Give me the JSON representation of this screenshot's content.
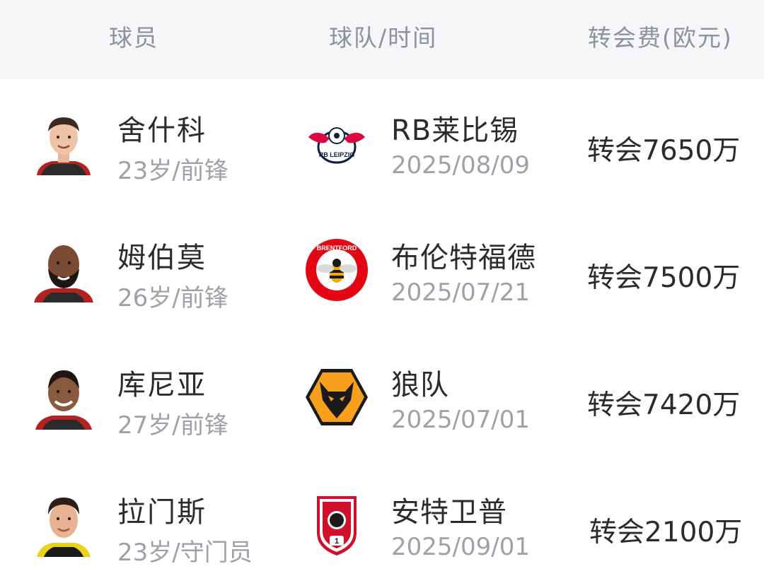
{
  "header": {
    "player_label": "球员",
    "team_time_label": "球队/时间",
    "fee_label": "转会费(欧元)"
  },
  "rows": [
    {
      "player_name": "舍什科",
      "player_info": "23岁/前锋",
      "team_name": "RB莱比锡",
      "date": "2025/08/09",
      "fee": "转会7650万",
      "logo_text": "RB LEIPZIG"
    },
    {
      "player_name": "姆伯莫",
      "player_info": "26岁/前锋",
      "team_name": "布伦特福德",
      "date": "2025/07/21",
      "fee": "转会7500万",
      "logo_text": "BRENTFORD"
    },
    {
      "player_name": "库尼亚",
      "player_info": "27岁/前锋",
      "team_name": "狼队",
      "date": "2025/07/01",
      "fee": "转会7420万"
    },
    {
      "player_name": "拉门斯",
      "player_info": "23岁/守门员",
      "team_name": "安特卫普",
      "date": "2025/09/01",
      "fee": "转会2100万",
      "logo_text": "1"
    }
  ]
}
